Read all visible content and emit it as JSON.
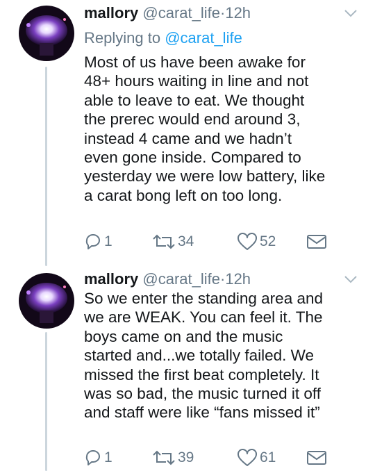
{
  "tweets": [
    {
      "name": "mallory",
      "handle": "@carat_life",
      "dot": "·",
      "time": "12h",
      "replying_prefix": "Replying to",
      "replying_handle": "@carat_life",
      "lines": [
        "Most of us have been awake for",
        "48+ hours waiting in line and not",
        "able to leave to eat. We thought",
        "the prerec would end around 3,",
        "instead 4 came and we hadn’t",
        "even gone inside. Compared to",
        "yesterday we were low battery, like",
        "a carat bong left on too long."
      ],
      "reply_count": "1",
      "retweet_count": "34",
      "like_count": "52",
      "icons": [
        "avatar",
        "chevron-down-icon",
        "reply-icon",
        "retweet-icon",
        "like-icon",
        "message-icon"
      ]
    },
    {
      "name": "mallory",
      "handle": "@carat_life",
      "dot": "·",
      "time": "12h",
      "lines": [
        "So we enter the standing area and",
        "we are WEAK. You can feel it. The",
        "boys came on and the music",
        "started and...we totally failed. We",
        "missed the first beat completely. It",
        "was so bad, the music turned it off",
        "and staff were like “fans missed it”"
      ],
      "reply_count": "1",
      "retweet_count": "39",
      "like_count": "61",
      "icons": [
        "avatar",
        "chevron-down-icon",
        "reply-icon",
        "retweet-icon",
        "like-icon",
        "message-icon"
      ]
    }
  ],
  "colors": {
    "text": "#14171a",
    "secondary": "#657786",
    "link": "#1da1f2",
    "thread_line": "#ccd6dd"
  }
}
